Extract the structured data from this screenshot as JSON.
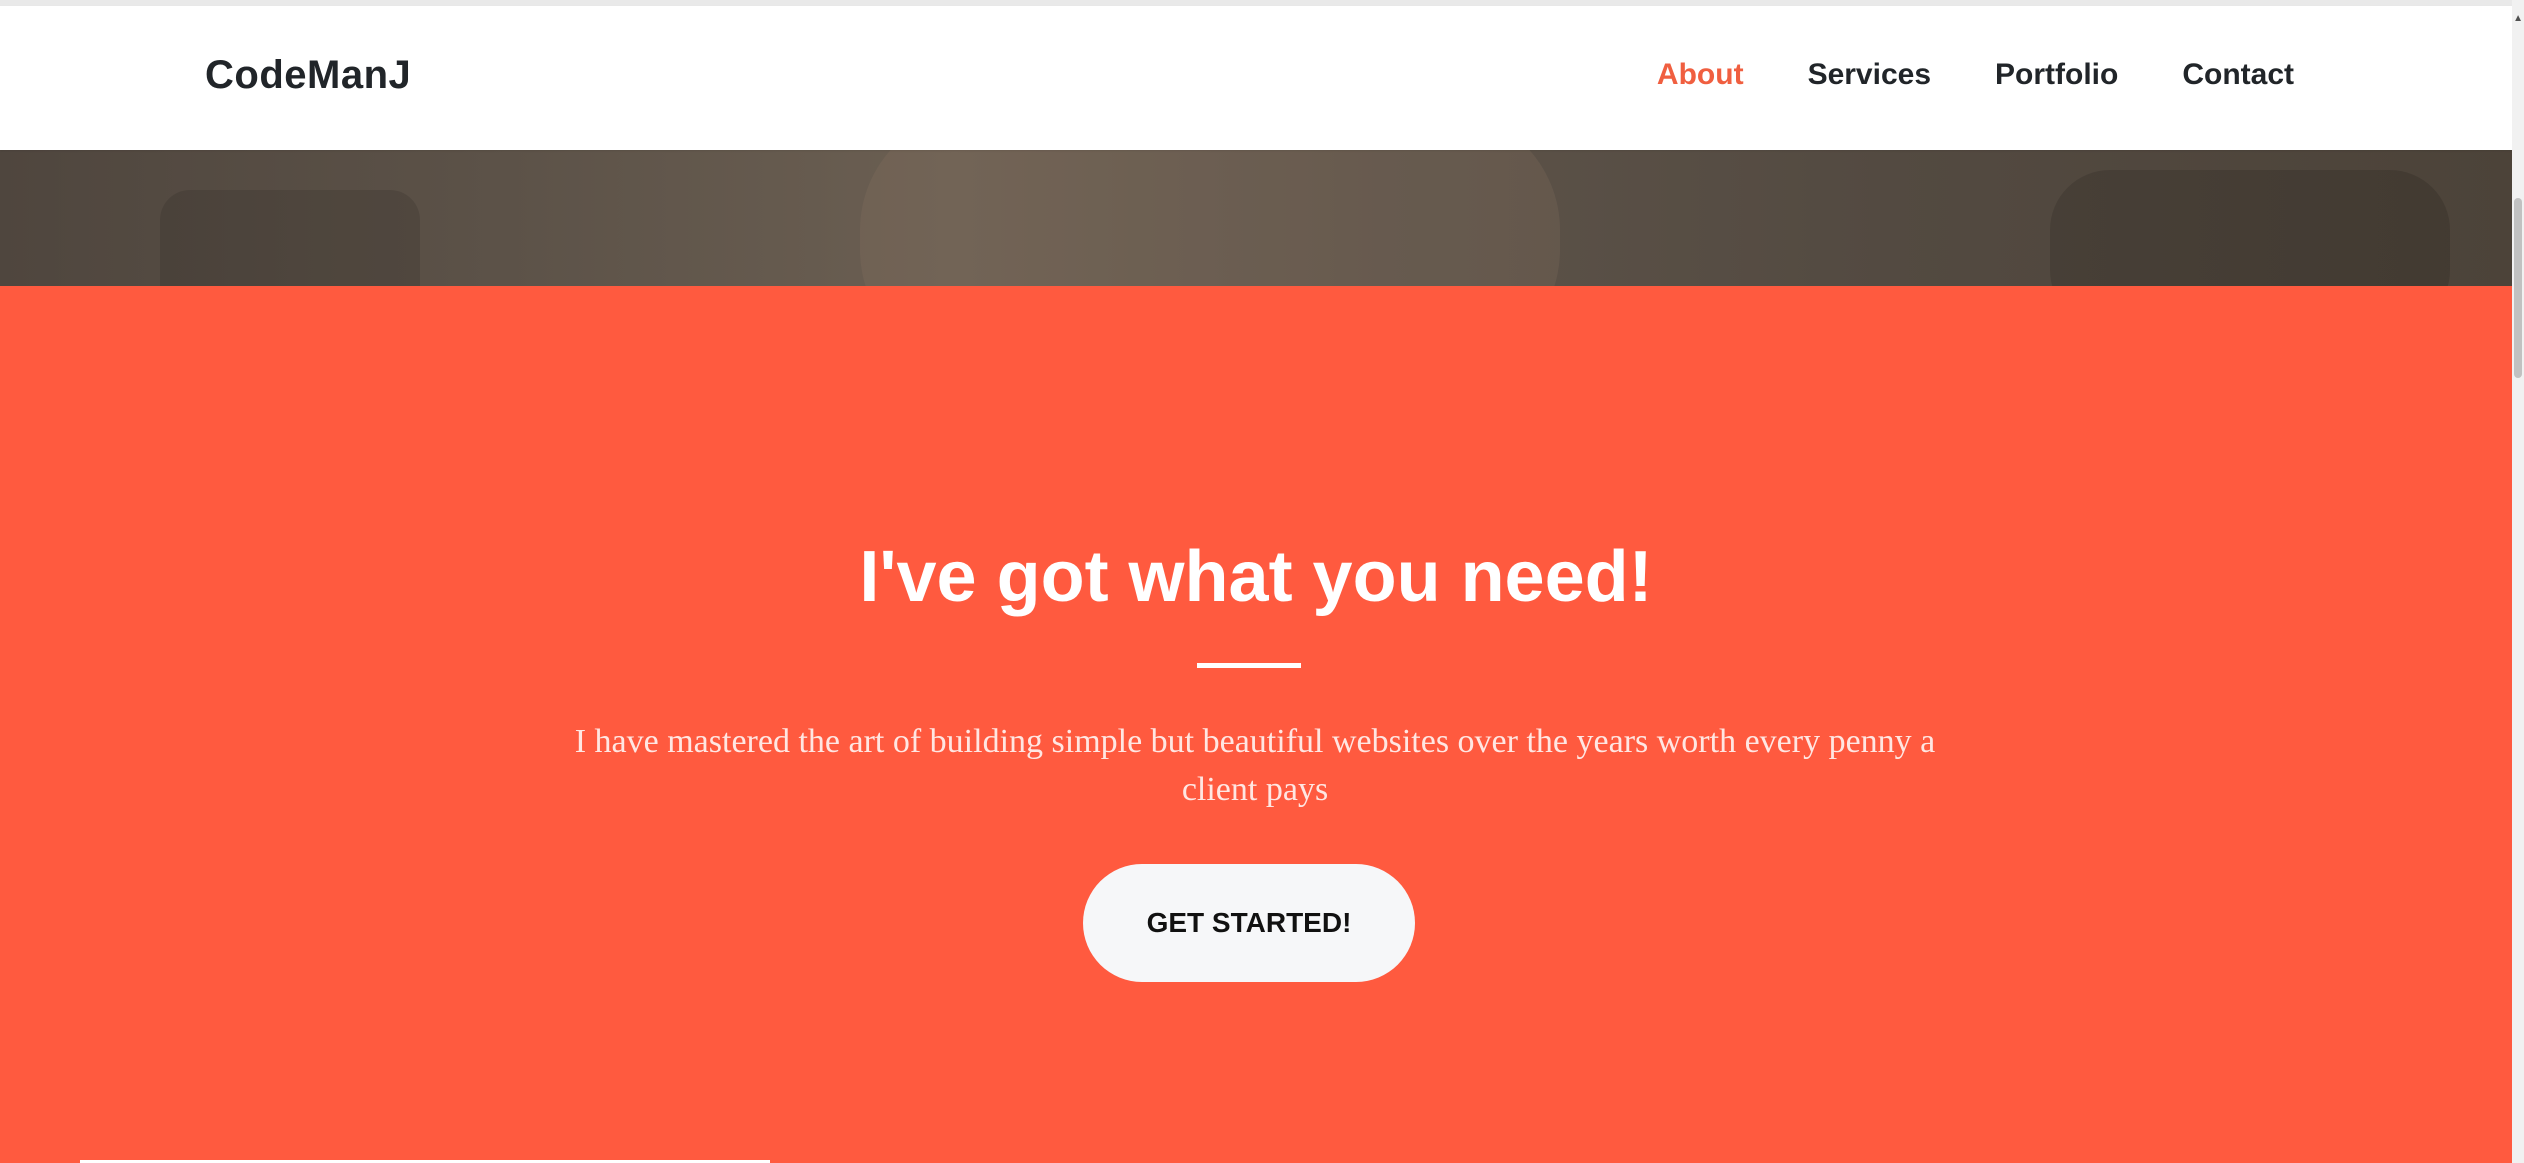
{
  "navbar": {
    "brand": "CodeManJ",
    "links": [
      {
        "label": "About",
        "active": true
      },
      {
        "label": "Services",
        "active": false
      },
      {
        "label": "Portfolio",
        "active": false
      },
      {
        "label": "Contact",
        "active": false
      }
    ]
  },
  "about": {
    "heading": "I've got what you need!",
    "lead": "I have mastered the art of building simple but beautiful websites over the years worth every penny a client pays",
    "cta_label": "GET STARTED!"
  },
  "scrollbar": {
    "up_arrow_icon": "triangle-up-icon"
  },
  "colors": {
    "accent": "#ff5a3f",
    "active_link": "#f05f40",
    "button_bg": "#f6f7f9",
    "text_dark": "#212529"
  }
}
